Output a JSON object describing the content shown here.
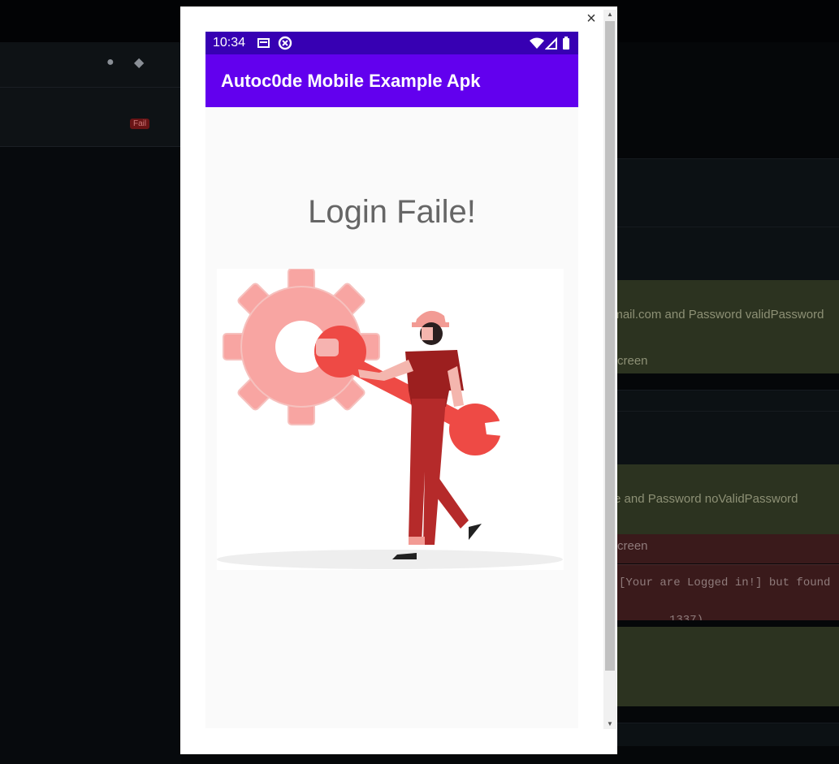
{
  "background": {
    "fail_badge": "Fail",
    "row_login_valid": "gmail.com and Password validPassword",
    "row_screen_1": "creen",
    "row_login_invalid": "e and Password noValidPassword",
    "row_screen_2": "creen",
    "row_error_line1": "[Your are Logged in!] but found",
    "row_error_line2": "1337)"
  },
  "modal": {
    "close_label": "×",
    "scroll_up": "▲",
    "scroll_down": "▼"
  },
  "phone": {
    "status_time": "10:34",
    "app_title": "Autoc0de Mobile Example Apk",
    "heading": "Login Faile!"
  },
  "colors": {
    "status_bar": "#3700b3",
    "app_bar": "#6200ee",
    "accent_red": "#e8463f"
  }
}
